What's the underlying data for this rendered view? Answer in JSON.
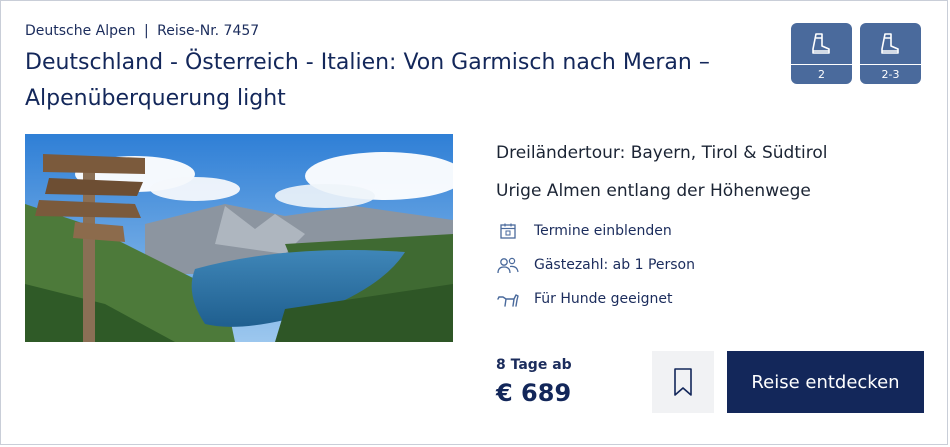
{
  "tour": {
    "region": "Deutsche Alpen",
    "separator": "|",
    "trip_number": "Reise-Nr. 7457",
    "title": "Deutschland - Österreich - Italien: Von Garmisch nach Meran – Alpenüberquerung light"
  },
  "difficulty_badges": [
    {
      "icon": "hiking-boot-icon",
      "label": "2"
    },
    {
      "icon": "hiking-boot-icon",
      "label": "2-3"
    }
  ],
  "highlights": [
    "Dreiländertour: Bayern, Tirol & Südtirol",
    "Urige Almen entlang der Höhenwege"
  ],
  "features": [
    {
      "icon": "calendar-icon",
      "label": "Termine einblenden"
    },
    {
      "icon": "group-icon",
      "label": "Gästezahl: ab 1 Person"
    },
    {
      "icon": "dog-icon",
      "label": "Für Hunde geeignet"
    }
  ],
  "pricing": {
    "duration_label": "8 Tage ab",
    "price": "€ 689"
  },
  "actions": {
    "bookmark_icon": "bookmark-icon",
    "cta_label": "Reise entdecken"
  },
  "colors": {
    "primary": "#13275a",
    "badge": "#4a6a9c",
    "bookmark_bg": "#f1f2f4"
  }
}
